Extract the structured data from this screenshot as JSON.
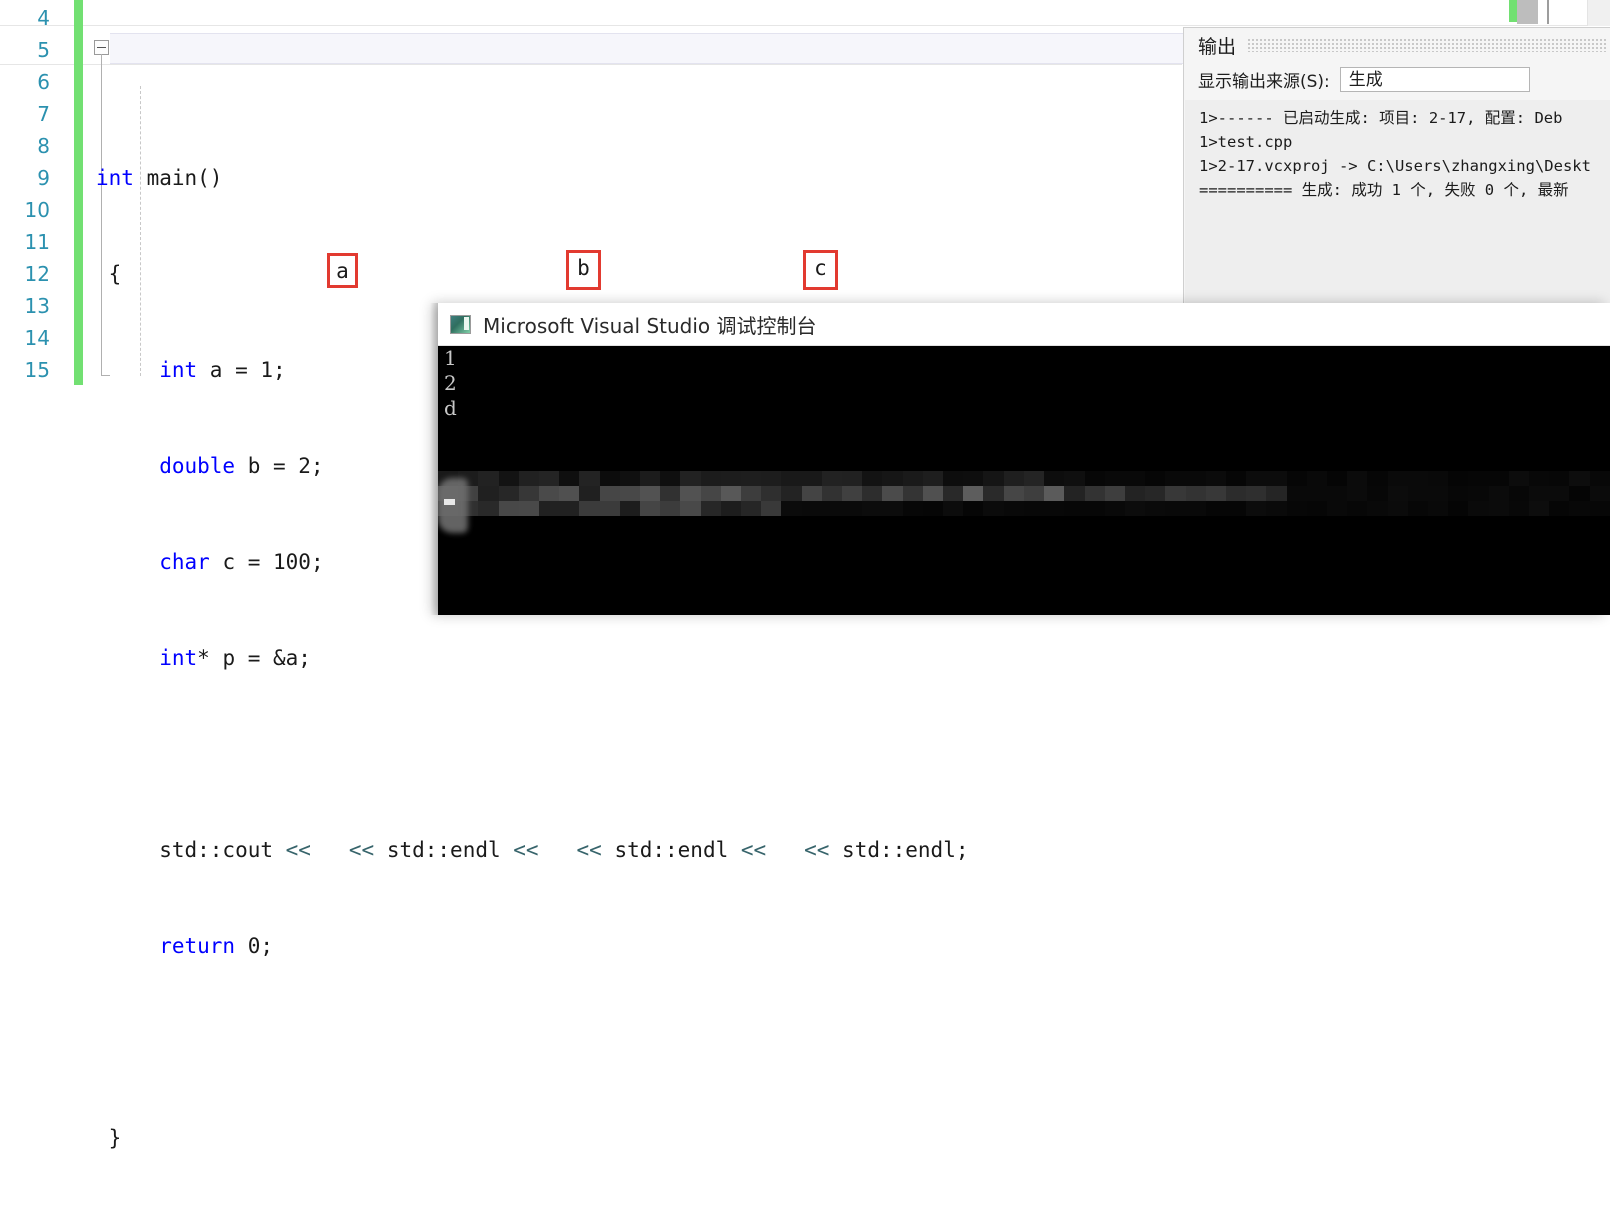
{
  "editor": {
    "line_numbers": [
      "4",
      "5",
      "6",
      "7",
      "8",
      "9",
      "10",
      "11",
      "12",
      "13",
      "14",
      "15"
    ],
    "code_lines": [
      {
        "id": "l4",
        "text": ""
      },
      {
        "id": "l5",
        "text": "int main()"
      },
      {
        "id": "l6",
        "text": "{"
      },
      {
        "id": "l7",
        "text": "    int a = 1;"
      },
      {
        "id": "l8",
        "text": "    double b = 2;"
      },
      {
        "id": "l9",
        "text": "    char c = 100;"
      },
      {
        "id": "l10",
        "text": "    int* p = &a;"
      },
      {
        "id": "l11",
        "text": ""
      },
      {
        "id": "l12",
        "text": "    std::cout << a << std::endl << b << std::endl << c << std::endl;"
      },
      {
        "id": "l13",
        "text": "    return 0;"
      },
      {
        "id": "l14",
        "text": ""
      },
      {
        "id": "l15",
        "text": "}"
      }
    ],
    "tokens": {
      "kw_int": "int",
      "kw_double": "double",
      "kw_char": "char",
      "kw_return": "return",
      "fn_main": " main()",
      "brace_open": "{",
      "brace_close": "}",
      "decl_a": " a = 1;",
      "decl_b": " b = 2;",
      "decl_c": " c = 100;",
      "decl_p": "* p = &a;",
      "cout": "std::cout ",
      "shift": "<<",
      "endl": " std::endl ",
      "endl_last": " std::endl;",
      "return_val": " 0;"
    },
    "highlighted_vars": [
      "a",
      "b",
      "c"
    ],
    "accent_colors": {
      "line_number": "#2b91af",
      "keyword": "#0000ff",
      "operator": "#37646b",
      "highlight_box": "#e23a30",
      "change_bar": "#72e072"
    }
  },
  "output_panel": {
    "title": "输出",
    "source_label": "显示输出来源(S):",
    "source_value": "生成",
    "lines": [
      "1>------ 已启动生成: 项目: 2-17, 配置: Deb",
      "1>test.cpp",
      "1>2-17.vcxproj -> C:\\Users\\zhangxing\\Deskt",
      "========== 生成: 成功 1 个, 失败 0 个, 最新"
    ]
  },
  "console": {
    "title": "Microsoft Visual Studio 调试控制台",
    "icon": "console-app-icon",
    "lines": [
      "1",
      "2",
      "d"
    ]
  }
}
